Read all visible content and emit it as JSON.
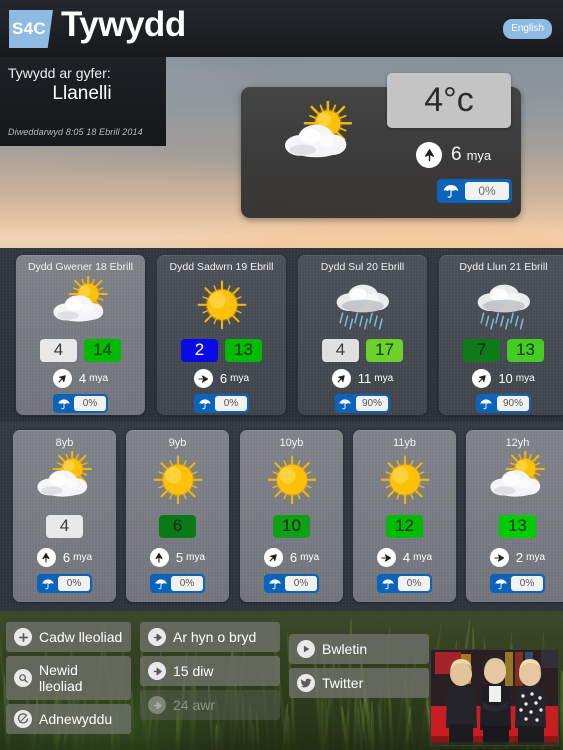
{
  "header": {
    "logo_text": "S4C",
    "title": "Tywydd",
    "lang_button": "English"
  },
  "location": {
    "label": "Tywydd ar gyfer:",
    "name": "Llanelli",
    "updated": "Diweddarwyd 8:05 18 Ebrill 2014"
  },
  "current": {
    "temperature": "4°c",
    "icon": "sun-behind-cloud-icon",
    "wind_speed": "6",
    "wind_unit": "mya",
    "wind_dir": "s",
    "rain_chance": "0%"
  },
  "days": [
    {
      "title": "Dydd Gwener 18 Ebrill",
      "icon": "sun-behind-cloud-icon",
      "min": "4",
      "min_color": "#e8e8e8",
      "min_text": "#3a3a3a",
      "max": "14",
      "max_color": "#00bb00",
      "max_text": "#103010",
      "wind_speed": "4",
      "wind_unit": "mya",
      "wind_dir": "sw",
      "rain_chance": "0%",
      "selected": true
    },
    {
      "title": "Dydd Sadwrn 19 Ebrill",
      "icon": "sun-icon",
      "min": "2",
      "min_color": "#0a0ae6",
      "min_text": "#ffffff",
      "max": "13",
      "max_color": "#00bb00",
      "max_text": "#103010",
      "wind_speed": "6",
      "wind_unit": "mya",
      "wind_dir": "w",
      "rain_chance": "0%",
      "selected": false
    },
    {
      "title": "Dydd Sul 20 Ebrill",
      "icon": "rain-cloud-icon",
      "min": "4",
      "min_color": "#e0e0e0",
      "min_text": "#3a3a3a",
      "max": "17",
      "max_color": "#6ed02a",
      "max_text": "#173510",
      "wind_speed": "11",
      "wind_unit": "mya",
      "wind_dir": "sw",
      "rain_chance": "90%",
      "selected": false
    },
    {
      "title": "Dydd Llun 21 Ebrill",
      "icon": "rain-cloud-icon",
      "min": "7",
      "min_color": "#0f7a18",
      "min_text": "#0b2a0b",
      "max": "13",
      "max_color": "#44cc22",
      "max_text": "#123212",
      "wind_speed": "10",
      "wind_unit": "mya",
      "wind_dir": "sw",
      "rain_chance": "90%",
      "selected": false
    }
  ],
  "hours": [
    {
      "title": "8yb",
      "icon": "sun-behind-cloud-icon",
      "temp": "4",
      "temp_color": "#e8e8e8",
      "temp_text": "#3a3a3a",
      "wind_speed": "6",
      "wind_unit": "mya",
      "wind_dir": "s",
      "rain_chance": "0%"
    },
    {
      "title": "9yb",
      "icon": "sun-icon",
      "temp": "6",
      "temp_color": "#0a7a18",
      "temp_text": "#0b2a0b",
      "wind_speed": "5",
      "wind_unit": "mya",
      "wind_dir": "s",
      "rain_chance": "0%"
    },
    {
      "title": "10yb",
      "icon": "sun-icon",
      "temp": "10",
      "temp_color": "#10a018",
      "temp_text": "#0b2a0b",
      "wind_speed": "6",
      "wind_unit": "mya",
      "wind_dir": "sw",
      "rain_chance": "0%"
    },
    {
      "title": "11yb",
      "icon": "sun-icon",
      "temp": "12",
      "temp_color": "#00bb00",
      "temp_text": "#103010",
      "wind_speed": "4",
      "wind_unit": "mya",
      "wind_dir": "w",
      "rain_chance": "0%"
    },
    {
      "title": "12yh",
      "icon": "sun-behind-cloud-icon",
      "temp": "13",
      "temp_color": "#00cc00",
      "temp_text": "#103010",
      "wind_speed": "2",
      "wind_unit": "mya",
      "wind_dir": "w",
      "rain_chance": "0%"
    }
  ],
  "toolbar": {
    "left": [
      {
        "label": "Cadw lleoliad",
        "icon": "plus-icon",
        "glyph": "+",
        "disabled": false
      },
      {
        "label": "Newid lleoliad",
        "icon": "search-icon",
        "glyph": "⚲",
        "disabled": false
      },
      {
        "label": "Adnewyddu",
        "icon": "refresh-icon",
        "glyph": "↻",
        "disabled": false
      }
    ],
    "middle": [
      {
        "label": "Ar hyn o bryd",
        "icon": "arrow-right-icon",
        "glyph": "➤",
        "disabled": false
      },
      {
        "label": "15 diw",
        "icon": "arrow-right-icon",
        "glyph": "➤",
        "disabled": false
      },
      {
        "label": "24 awr",
        "icon": "arrow-right-icon",
        "glyph": "➤",
        "disabled": true
      }
    ],
    "right": [
      {
        "label": "Bwletin",
        "icon": "play-icon",
        "glyph": "▶",
        "disabled": false
      },
      {
        "label": "Twitter",
        "icon": "twitter-icon",
        "glyph": "ᴮ",
        "disabled": false
      }
    ]
  },
  "photo": {
    "name": "presenters-thumbnail"
  }
}
